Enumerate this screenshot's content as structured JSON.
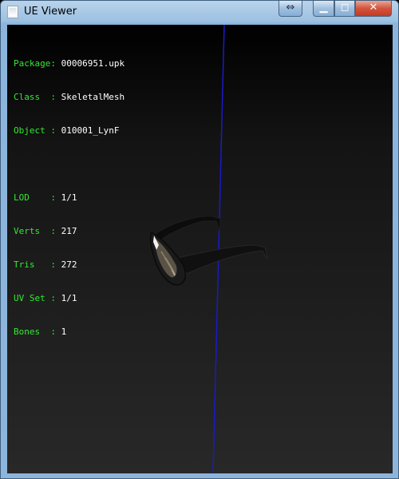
{
  "window": {
    "title": "UE Viewer",
    "icon": "app-icon",
    "controls": {
      "restore_x_glyph": "⇔",
      "minimize_glyph": "▁",
      "maximize_glyph": "◻",
      "close_glyph": "✕"
    }
  },
  "info": {
    "package": {
      "label": "Package:",
      "value": "00006951.upk"
    },
    "class": {
      "label": "Class  :",
      "value": "SkeletalMesh"
    },
    "object": {
      "label": "Object :",
      "value": "010001_LynF"
    },
    "lod": {
      "label": "LOD    :",
      "value": "1/1"
    },
    "verts": {
      "label": "Verts  :",
      "value": "217"
    },
    "tris": {
      "label": "Tris   :",
      "value": "272"
    },
    "uvset": {
      "label": "UV Set :",
      "value": "1/1"
    },
    "bones": {
      "label": "Bones  :",
      "value": "1"
    }
  },
  "colors": {
    "label_green": "#33e833",
    "value_white": "#ffffff",
    "axis_blue": "#1a1acc",
    "close_red": "#c53a22"
  }
}
